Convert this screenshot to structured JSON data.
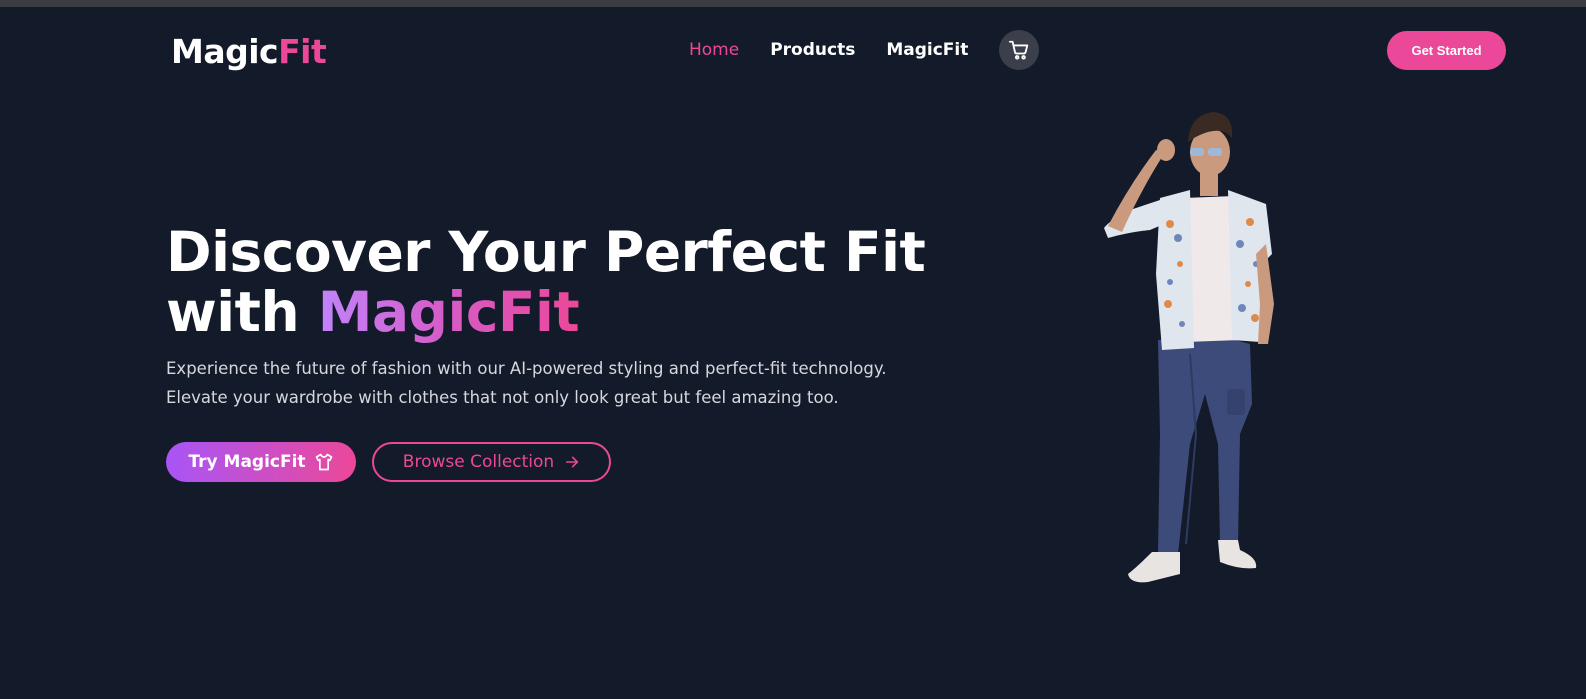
{
  "header": {
    "logo_main": "Magic",
    "logo_accent": "Fit",
    "nav": [
      {
        "label": "Home",
        "active": true
      },
      {
        "label": "Products",
        "active": false
      },
      {
        "label": "MagicFit",
        "active": false
      }
    ],
    "cart_icon": "shopping-cart-icon",
    "get_started_label": "Get Started"
  },
  "hero": {
    "title_line1": "Discover Your Perfect Fit",
    "title_line2_prefix": "with ",
    "title_line2_brand": "MagicFit",
    "description_line1": "Experience the future of fashion with our AI-powered styling and perfect-fit technology.",
    "description_line2": "Elevate your wardrobe with clothes that not only look great but feel amazing too.",
    "primary_button_label": "Try MagicFit",
    "primary_button_icon": "tshirt-icon",
    "secondary_button_label": "Browse Collection",
    "secondary_button_icon": "arrow-right-icon"
  },
  "colors": {
    "background": "#131a29",
    "accent": "#ec4899",
    "gradient_start": "#a855f7"
  }
}
